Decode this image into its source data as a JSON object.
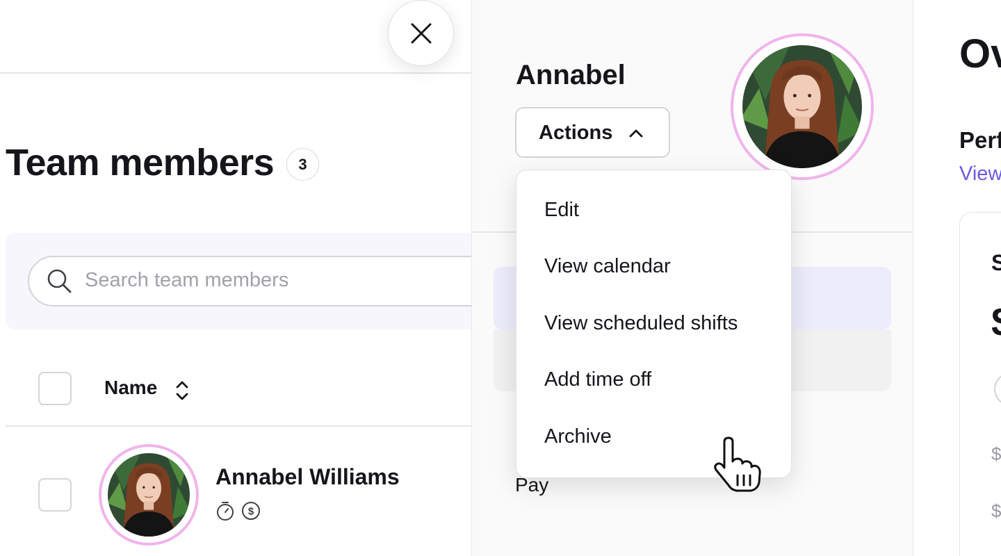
{
  "team": {
    "title": "Team members",
    "count": "3",
    "search_placeholder": "Search team members",
    "column_name": "Name",
    "members": [
      {
        "name": "Annabel Williams",
        "icons": [
          "timer-icon",
          "dollar-icon"
        ]
      }
    ]
  },
  "profile": {
    "first_name": "Annabel",
    "actions_label": "Actions",
    "pay_label": "Pay"
  },
  "actions_menu": {
    "items": [
      "Edit",
      "View calendar",
      "View scheduled shifts",
      "Add time off",
      "Archive"
    ]
  },
  "right_panel": {
    "title_partial": "Ov",
    "subtitle_partial": "Perf",
    "link_partial": "View",
    "card_label_partial": "S",
    "card_value_partial": "$",
    "card_row1_partial": "$",
    "card_row2_partial": "$"
  },
  "colors": {
    "accent_link": "#6a5ae0",
    "avatar_ring": "#f0b4ec",
    "tab_active_bg": "#ececfb",
    "search_bar_bg": "#f6f6fc"
  }
}
